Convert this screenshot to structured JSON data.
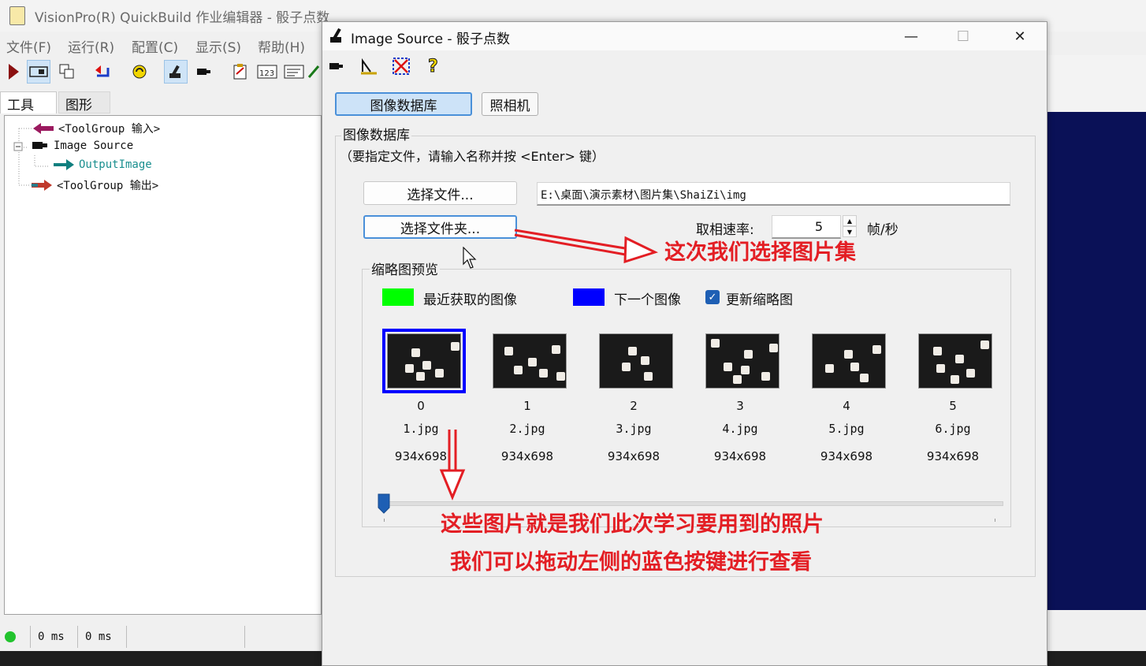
{
  "app": {
    "title": "VisionPro(R) QuickBuild 作业编辑器 - 骰子点数",
    "menu": [
      "文件(F)",
      "运行(R)",
      "配置(C)",
      "显示(S)",
      "帮助(H)"
    ],
    "tabs": [
      "工具",
      "图形"
    ],
    "tree": [
      {
        "label": "<ToolGroup 输入>",
        "icon": "input-arrow-icon"
      },
      {
        "label": "Image Source",
        "icon": "camera-icon"
      },
      {
        "label": "OutputImage",
        "icon": "output-arrow-icon"
      },
      {
        "label": "<ToolGroup 输出>",
        "icon": "output-group-icon"
      }
    ],
    "status": {
      "time1": "0 ms",
      "time2": "0 ms",
      "indicator_color": "#22c32e"
    }
  },
  "dialog": {
    "title": "Image Source - 骰子点数",
    "window_controls": {
      "minimize": "—",
      "maximize": "☐",
      "close": "✕"
    },
    "tabs": {
      "database": "图像数据库",
      "camera": "照相机"
    },
    "group_title": "图像数据库",
    "hint": "（要指定文件，请输入名称并按 <Enter> 键）",
    "select_file": "选择文件...",
    "select_folder": "选择文件夹...",
    "path": "E:\\桌面\\演示素材\\图片集\\ShaiZi\\img",
    "rate_label": "取相速率:",
    "rate_value": "5",
    "rate_unit": "帧/秒",
    "thumb_group_title": "缩略图预览",
    "legend": {
      "recent": {
        "label": "最近获取的图像",
        "color": "#00ff00"
      },
      "next": {
        "label": "下一个图像",
        "color": "#0000ff"
      },
      "update": {
        "label": "更新缩略图",
        "checked": true
      }
    },
    "thumbnails": [
      {
        "index": "0",
        "name": "1.jpg",
        "size": "934x698"
      },
      {
        "index": "1",
        "name": "2.jpg",
        "size": "934x698"
      },
      {
        "index": "2",
        "name": "3.jpg",
        "size": "934x698"
      },
      {
        "index": "3",
        "name": "4.jpg",
        "size": "934x698"
      },
      {
        "index": "4",
        "name": "5.jpg",
        "size": "934x698"
      },
      {
        "index": "5",
        "name": "6.jpg",
        "size": "934x698"
      }
    ],
    "slider_position": 0
  },
  "annotations": {
    "folder_note": "这次我们选择图片集",
    "photos_note": "这些图片就是我们此次学习要用到的照片",
    "slider_note": "我们可以拖动左侧的蓝色按键进行查看",
    "color": "#e31e24"
  }
}
